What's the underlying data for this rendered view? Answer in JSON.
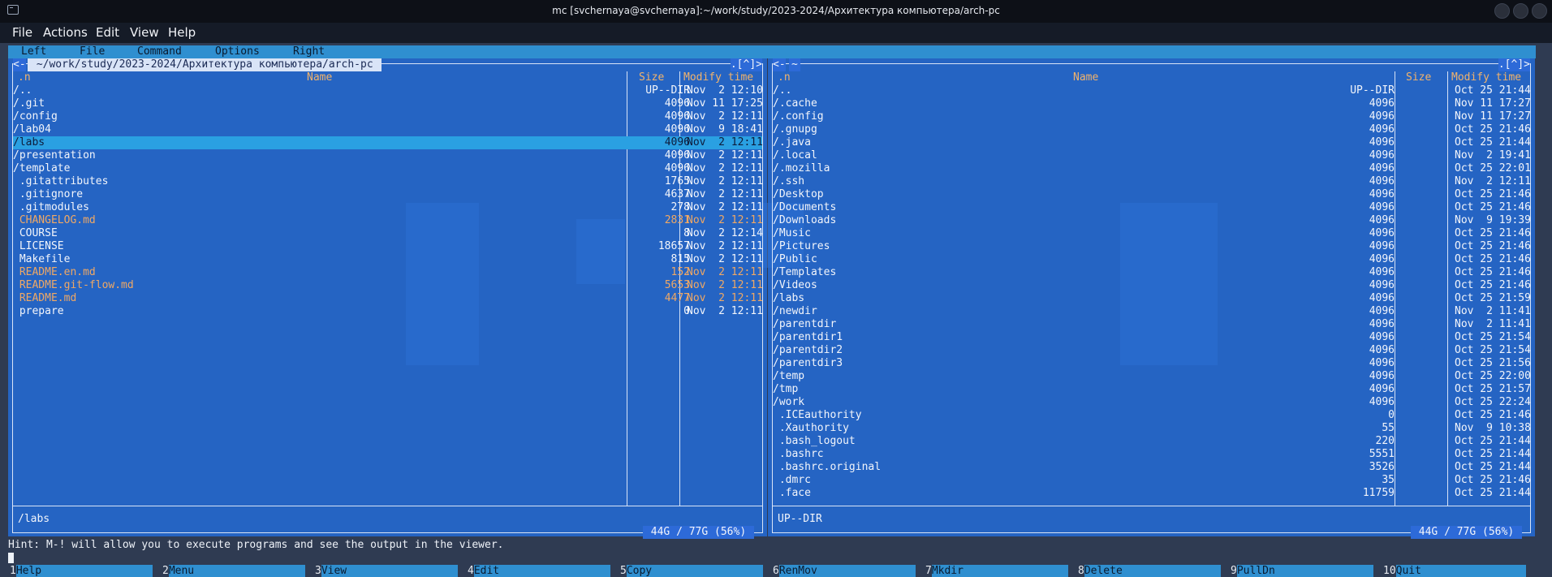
{
  "window": {
    "title": "mc [svchernaya@svchernaya]:~/work/study/2023-2024/Архитектура компьютера/arch-pc"
  },
  "app_menu": [
    "File",
    "Actions",
    "Edit",
    "View",
    "Help"
  ],
  "mc_menu": [
    "Left",
    "File",
    "Command",
    "Options",
    "Right"
  ],
  "left_panel": {
    "path": " ~/work/study/2023-2024/Архитектура компьютера/arch-pc ",
    "corner_left": "<-",
    "corner_right": ".[^]>",
    "header": {
      "sort": ".n",
      "name": "Name",
      "size": "Size",
      "time": "Modify time"
    },
    "rows": [
      {
        "name": "/..",
        "size": "UP--DIR",
        "time": "Nov  2 12:10",
        "selected": false,
        "highlight": false
      },
      {
        "name": "/.git",
        "size": "4096",
        "time": "Nov 11 17:25",
        "selected": false,
        "highlight": false
      },
      {
        "name": "/config",
        "size": "4096",
        "time": "Nov  2 12:11",
        "selected": false,
        "highlight": false
      },
      {
        "name": "/lab04",
        "size": "4096",
        "time": "Nov  9 18:41",
        "selected": false,
        "highlight": false
      },
      {
        "name": "/labs",
        "size": "4096",
        "time": "Nov  2 12:11",
        "selected": true,
        "highlight": false
      },
      {
        "name": "/presentation",
        "size": "4096",
        "time": "Nov  2 12:11",
        "selected": false,
        "highlight": false
      },
      {
        "name": "/template",
        "size": "4096",
        "time": "Nov  2 12:11",
        "selected": false,
        "highlight": false
      },
      {
        "name": " .gitattributes",
        "size": "1765",
        "time": "Nov  2 12:11",
        "selected": false,
        "highlight": false
      },
      {
        "name": " .gitignore",
        "size": "4637",
        "time": "Nov  2 12:11",
        "selected": false,
        "highlight": false
      },
      {
        "name": " .gitmodules",
        "size": "278",
        "time": "Nov  2 12:11",
        "selected": false,
        "highlight": false
      },
      {
        "name": " CHANGELOG.md",
        "size": "2831",
        "time": "Nov  2 12:11",
        "selected": false,
        "highlight": true
      },
      {
        "name": " COURSE",
        "size": "8",
        "time": "Nov  2 12:14",
        "selected": false,
        "highlight": false
      },
      {
        "name": " LICENSE",
        "size": "18657",
        "time": "Nov  2 12:11",
        "selected": false,
        "highlight": false
      },
      {
        "name": " Makefile",
        "size": "815",
        "time": "Nov  2 12:11",
        "selected": false,
        "highlight": false
      },
      {
        "name": " README.en.md",
        "size": "152",
        "time": "Nov  2 12:11",
        "selected": false,
        "highlight": true
      },
      {
        "name": " README.git-flow.md",
        "size": "5653",
        "time": "Nov  2 12:11",
        "selected": false,
        "highlight": true
      },
      {
        "name": " README.md",
        "size": "4477",
        "time": "Nov  2 12:11",
        "selected": false,
        "highlight": true
      },
      {
        "name": " prepare",
        "size": "0",
        "time": "Nov  2 12:11",
        "selected": false,
        "highlight": false
      }
    ],
    "status": "/labs",
    "free_space": " 44G / 77G (56%) "
  },
  "right_panel": {
    "path": "~",
    "corner_left": "<-",
    "corner_right": ".[^]>",
    "header": {
      "sort": ".n",
      "name": "Name",
      "size": "Size",
      "time": "Modify time"
    },
    "rows": [
      {
        "name": "/..",
        "size": "UP--DIR",
        "time": "Oct 25 21:44"
      },
      {
        "name": "/.cache",
        "size": "4096",
        "time": "Nov 11 17:27"
      },
      {
        "name": "/.config",
        "size": "4096",
        "time": "Nov 11 17:27"
      },
      {
        "name": "/.gnupg",
        "size": "4096",
        "time": "Oct 25 21:46"
      },
      {
        "name": "/.java",
        "size": "4096",
        "time": "Oct 25 21:44"
      },
      {
        "name": "/.local",
        "size": "4096",
        "time": "Nov  2 19:41"
      },
      {
        "name": "/.mozilla",
        "size": "4096",
        "time": "Oct 25 22:01"
      },
      {
        "name": "/.ssh",
        "size": "4096",
        "time": "Nov  2 12:11"
      },
      {
        "name": "/Desktop",
        "size": "4096",
        "time": "Oct 25 21:46"
      },
      {
        "name": "/Documents",
        "size": "4096",
        "time": "Oct 25 21:46"
      },
      {
        "name": "/Downloads",
        "size": "4096",
        "time": "Nov  9 19:39"
      },
      {
        "name": "/Music",
        "size": "4096",
        "time": "Oct 25 21:46"
      },
      {
        "name": "/Pictures",
        "size": "4096",
        "time": "Oct 25 21:46"
      },
      {
        "name": "/Public",
        "size": "4096",
        "time": "Oct 25 21:46"
      },
      {
        "name": "/Templates",
        "size": "4096",
        "time": "Oct 25 21:46"
      },
      {
        "name": "/Videos",
        "size": "4096",
        "time": "Oct 25 21:46"
      },
      {
        "name": "/labs",
        "size": "4096",
        "time": "Oct 25 21:59"
      },
      {
        "name": "/newdir",
        "size": "4096",
        "time": "Nov  2 11:41"
      },
      {
        "name": "/parentdir",
        "size": "4096",
        "time": "Nov  2 11:41"
      },
      {
        "name": "/parentdir1",
        "size": "4096",
        "time": "Oct 25 21:54"
      },
      {
        "name": "/parentdir2",
        "size": "4096",
        "time": "Oct 25 21:54"
      },
      {
        "name": "/parentdir3",
        "size": "4096",
        "time": "Oct 25 21:56"
      },
      {
        "name": "/temp",
        "size": "4096",
        "time": "Oct 25 22:00"
      },
      {
        "name": "/tmp",
        "size": "4096",
        "time": "Oct 25 21:57"
      },
      {
        "name": "/work",
        "size": "4096",
        "time": "Oct 25 22:24"
      },
      {
        "name": " .ICEauthority",
        "size": "0",
        "time": "Oct 25 21:46"
      },
      {
        "name": " .Xauthority",
        "size": "55",
        "time": "Nov  9 10:38"
      },
      {
        "name": " .bash_logout",
        "size": "220",
        "time": "Oct 25 21:44"
      },
      {
        "name": " .bashrc",
        "size": "5551",
        "time": "Oct 25 21:44"
      },
      {
        "name": " .bashrc.original",
        "size": "3526",
        "time": "Oct 25 21:44"
      },
      {
        "name": " .dmrc",
        "size": "35",
        "time": "Oct 25 21:46"
      },
      {
        "name": " .face",
        "size": "11759",
        "time": "Oct 25 21:44"
      }
    ],
    "status": "UP--DIR",
    "free_space": " 44G / 77G (56%) "
  },
  "hint": "Hint: M-! will allow you to execute programs and see the output in the viewer.",
  "function_keys": [
    {
      "num": "1",
      "label": "Help"
    },
    {
      "num": "2",
      "label": "Menu"
    },
    {
      "num": "3",
      "label": "View"
    },
    {
      "num": "4",
      "label": "Edit"
    },
    {
      "num": "5",
      "label": "Copy"
    },
    {
      "num": "6",
      "label": "RenMov"
    },
    {
      "num": "7",
      "label": "Mkdir"
    },
    {
      "num": "8",
      "label": "Delete"
    },
    {
      "num": "9",
      "label": "PullDn"
    },
    {
      "num": "10",
      "label": "Quit"
    }
  ]
}
